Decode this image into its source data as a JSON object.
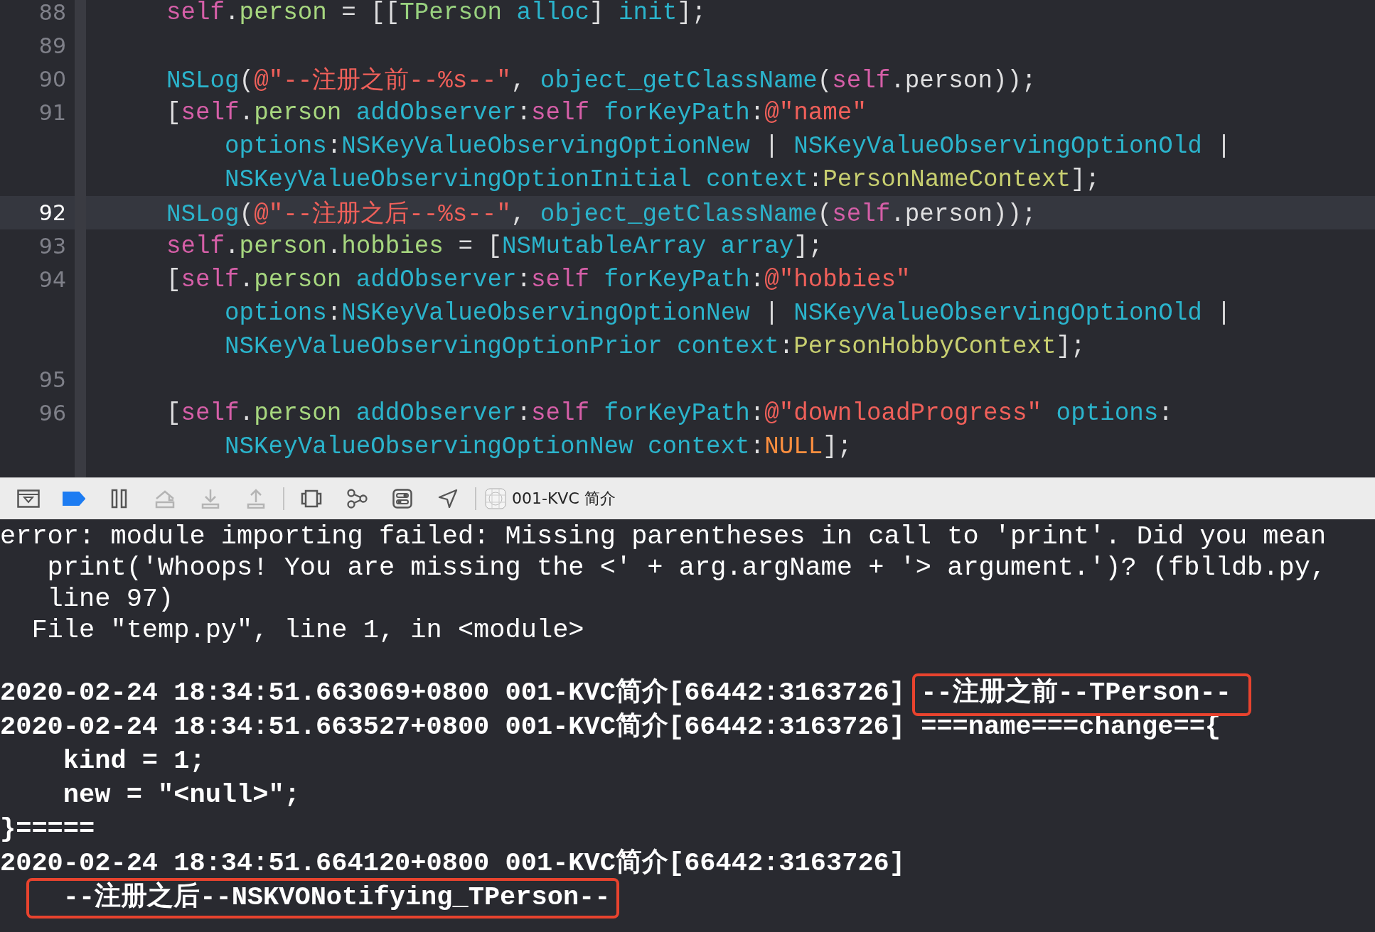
{
  "editor": {
    "rows": [
      {
        "number": "88",
        "current": false,
        "tokens": [
          {
            "t": "self",
            "kind": "keyword"
          },
          {
            "t": ".",
            "kind": "plain"
          },
          {
            "t": "person",
            "kind": "property"
          },
          {
            "t": " = [[",
            "kind": "plain"
          },
          {
            "t": "TPerson",
            "kind": "class"
          },
          {
            "t": " alloc",
            "kind": "method"
          },
          {
            "t": "] ",
            "kind": "plain"
          },
          {
            "t": "init",
            "kind": "method"
          },
          {
            "t": "];",
            "kind": "plain"
          }
        ]
      },
      {
        "number": "89",
        "current": false
      },
      {
        "number": "90",
        "current": false,
        "tokens": [
          {
            "t": "NSLog",
            "kind": "method"
          },
          {
            "t": "(",
            "kind": "plain"
          },
          {
            "t": "@\"--注册之前--%s--\"",
            "kind": "string"
          },
          {
            "t": ", ",
            "kind": "plain"
          },
          {
            "t": "object_getClassName",
            "kind": "method"
          },
          {
            "t": "(",
            "kind": "plain"
          },
          {
            "t": "self",
            "kind": "keyword"
          },
          {
            "t": ".person));",
            "kind": "plain"
          }
        ]
      },
      {
        "number": "91",
        "current": false,
        "tokens": [
          {
            "t": "[",
            "kind": "plain"
          },
          {
            "t": "self",
            "kind": "keyword"
          },
          {
            "t": ".",
            "kind": "plain"
          },
          {
            "t": "person",
            "kind": "property"
          },
          {
            "t": " addObserver",
            "kind": "method"
          },
          {
            "t": ":",
            "kind": "plain"
          },
          {
            "t": "self",
            "kind": "keyword"
          },
          {
            "t": " forKeyPath",
            "kind": "method"
          },
          {
            "t": ":",
            "kind": "plain"
          },
          {
            "t": "@\"name\"",
            "kind": "string"
          }
        ]
      },
      {
        "current": false,
        "tokens": [
          {
            "t": "    options",
            "kind": "method"
          },
          {
            "t": ":",
            "kind": "plain"
          },
          {
            "t": "NSKeyValueObservingOptionNew",
            "kind": "method"
          },
          {
            "t": " | ",
            "kind": "plain"
          },
          {
            "t": "NSKeyValueObservingOptionOld",
            "kind": "method"
          },
          {
            "t": " |",
            "kind": "plain"
          }
        ]
      },
      {
        "current": false,
        "tokens": [
          {
            "t": "    NSKeyValueObservingOptionInitial context",
            "kind": "method"
          },
          {
            "t": ":",
            "kind": "plain"
          },
          {
            "t": "PersonNameContext",
            "kind": "global"
          },
          {
            "t": "];",
            "kind": "plain"
          }
        ]
      },
      {
        "number": "92",
        "current": true,
        "tokens": [
          {
            "t": "NSLog",
            "kind": "method"
          },
          {
            "t": "(",
            "kind": "plain"
          },
          {
            "t": "@\"--注册之后--%s--\"",
            "kind": "string"
          },
          {
            "t": ", ",
            "kind": "plain"
          },
          {
            "t": "object_getClassName",
            "kind": "method"
          },
          {
            "t": "(",
            "kind": "plain"
          },
          {
            "t": "self",
            "kind": "keyword"
          },
          {
            "t": ".person));",
            "kind": "plain"
          }
        ]
      },
      {
        "number": "93",
        "current": false,
        "tokens": [
          {
            "t": "self",
            "kind": "keyword"
          },
          {
            "t": ".",
            "kind": "plain"
          },
          {
            "t": "person",
            "kind": "property"
          },
          {
            "t": ".",
            "kind": "plain"
          },
          {
            "t": "hobbies",
            "kind": "property"
          },
          {
            "t": " = [",
            "kind": "plain"
          },
          {
            "t": "NSMutableArray array",
            "kind": "method"
          },
          {
            "t": "];",
            "kind": "plain"
          }
        ]
      },
      {
        "number": "94",
        "current": false,
        "tokens": [
          {
            "t": "[",
            "kind": "plain"
          },
          {
            "t": "self",
            "kind": "keyword"
          },
          {
            "t": ".",
            "kind": "plain"
          },
          {
            "t": "person",
            "kind": "property"
          },
          {
            "t": " addObserver",
            "kind": "method"
          },
          {
            "t": ":",
            "kind": "plain"
          },
          {
            "t": "self",
            "kind": "keyword"
          },
          {
            "t": " forKeyPath",
            "kind": "method"
          },
          {
            "t": ":",
            "kind": "plain"
          },
          {
            "t": "@\"hobbies\"",
            "kind": "string"
          }
        ]
      },
      {
        "current": false,
        "tokens": [
          {
            "t": "    options",
            "kind": "method"
          },
          {
            "t": ":",
            "kind": "plain"
          },
          {
            "t": "NSKeyValueObservingOptionNew",
            "kind": "method"
          },
          {
            "t": " | ",
            "kind": "plain"
          },
          {
            "t": "NSKeyValueObservingOptionOld",
            "kind": "method"
          },
          {
            "t": " |",
            "kind": "plain"
          }
        ]
      },
      {
        "current": false,
        "tokens": [
          {
            "t": "    NSKeyValueObservingOptionPrior context",
            "kind": "method"
          },
          {
            "t": ":",
            "kind": "plain"
          },
          {
            "t": "PersonHobbyContext",
            "kind": "global"
          },
          {
            "t": "];",
            "kind": "plain"
          }
        ]
      },
      {
        "number": "95",
        "current": false
      },
      {
        "number": "96",
        "current": false,
        "tokens": [
          {
            "t": "[",
            "kind": "plain"
          },
          {
            "t": "self",
            "kind": "keyword"
          },
          {
            "t": ".",
            "kind": "plain"
          },
          {
            "t": "person",
            "kind": "property"
          },
          {
            "t": " addObserver",
            "kind": "method"
          },
          {
            "t": ":",
            "kind": "plain"
          },
          {
            "t": "self",
            "kind": "keyword"
          },
          {
            "t": " forKeyPath",
            "kind": "method"
          },
          {
            "t": ":",
            "kind": "plain"
          },
          {
            "t": "@\"downloadProgress\"",
            "kind": "string"
          },
          {
            "t": " options",
            "kind": "method"
          },
          {
            "t": ":",
            "kind": "plain"
          }
        ]
      },
      {
        "current": false,
        "tokens": [
          {
            "t": "    NSKeyValueObservingOptionNew context",
            "kind": "method"
          },
          {
            "t": ":",
            "kind": "plain"
          },
          {
            "t": "NULL",
            "kind": "macro"
          },
          {
            "t": "];",
            "kind": "plain"
          }
        ]
      }
    ]
  },
  "debug_bar": {
    "buttons": [
      {
        "kind": "console",
        "disabled": false
      },
      {
        "kind": "breakpoints",
        "disabled": false,
        "active": true
      },
      {
        "kind": "pause",
        "disabled": false
      },
      {
        "kind": "step-over",
        "disabled": true
      },
      {
        "kind": "step-into",
        "disabled": true
      },
      {
        "kind": "step-out",
        "disabled": true
      },
      {
        "kind": "divider"
      },
      {
        "kind": "view-debugger",
        "disabled": false
      },
      {
        "kind": "memory-graph",
        "disabled": false
      },
      {
        "kind": "environment",
        "disabled": false
      },
      {
        "kind": "location",
        "disabled": false
      },
      {
        "kind": "divider"
      }
    ],
    "scheme": {
      "label": "001-KVC 简介"
    }
  },
  "console": {
    "lines": [
      {
        "kind": "plain",
        "text": "error: module importing failed: Missing parentheses in call to 'print'. Did you mean"
      },
      {
        "kind": "plain",
        "text": "   print('Whoops! You are missing the <' + arg.argName + '> argument.')? (fblldb.py,"
      },
      {
        "kind": "plain",
        "text": "   line 97)"
      },
      {
        "kind": "plain",
        "text": "  File \"temp.py\", line 1, in <module>"
      },
      {
        "kind": "blank"
      },
      {
        "kind": "log",
        "prefix": "2020-02-24 18:34:51.663069+0800 001-KVC简介[66442:3163726]",
        "message": "--注册之前--TPerson--",
        "boxed": true
      },
      {
        "kind": "log",
        "prefix": "2020-02-24 18:34:51.663527+0800 001-KVC简介[66442:3163726]",
        "message": "===name===change=={",
        "boxed": false
      },
      {
        "kind": "bold",
        "text": "    kind = 1;",
        "boxed": false
      },
      {
        "kind": "bold",
        "text": "    new = \"<null>\";",
        "boxed": false
      },
      {
        "kind": "bold",
        "text": "}=====",
        "boxed": false
      },
      {
        "kind": "log",
        "prefix": "2020-02-24 18:34:51.664120+0800 001-KVC简介[66442:3163726]",
        "boxed": false
      },
      {
        "kind": "bold",
        "text": "    --注册之后--NSKVONotifying_TPerson--",
        "boxed": true
      }
    ]
  }
}
